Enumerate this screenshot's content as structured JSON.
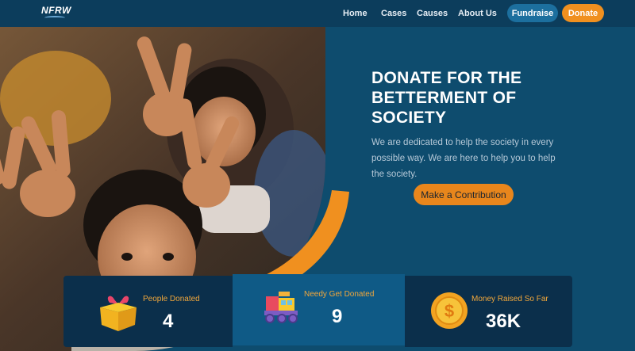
{
  "header": {
    "logo": "NFRW",
    "nav": [
      "Home",
      "Cases",
      "Causes",
      "About Us"
    ],
    "fundraise_label": "Fundraise",
    "donate_label": "Donate"
  },
  "hero": {
    "title": "DONATE FOR THE BETTERMENT OF SOCIETY",
    "description": "We are dedicated to help the society in every possible way. We are here to help you to help the society.",
    "cta_label": "Make a Contribution",
    "image_subject": "smiling children making peace signs"
  },
  "stats": [
    {
      "label": "People Donated",
      "value": "4",
      "icon": "gift-box-icon"
    },
    {
      "label": "Needy Get Donated",
      "value": "9",
      "icon": "toy-train-icon"
    },
    {
      "label": "Money Raised So Far",
      "value": "36K",
      "icon": "dollar-coin-icon"
    }
  ],
  "colors": {
    "background": "#0e4c6e",
    "navbar": "#0c3d5c",
    "accent_orange": "#f0901f",
    "fundraise_button": "#1c6f9e",
    "stat_dark": "#0b2f4b",
    "stat_highlight": "#0f5a86",
    "stat_label": "#f2a73b"
  }
}
